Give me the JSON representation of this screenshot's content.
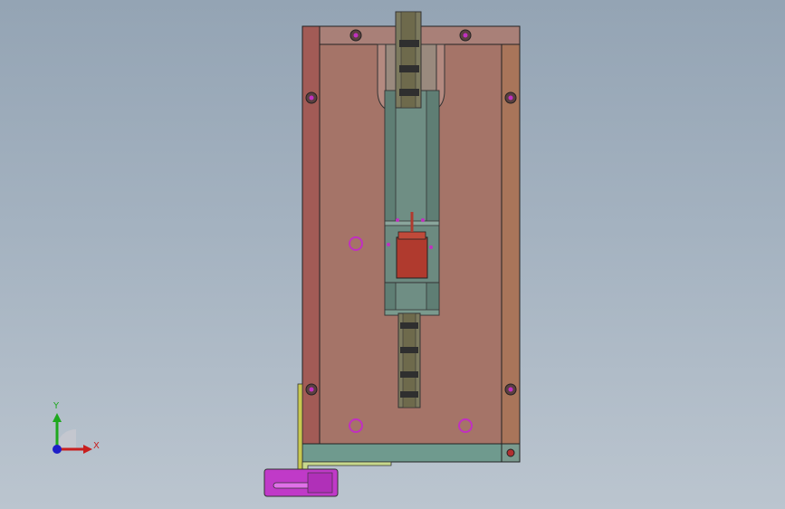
{
  "viewport": {
    "background_top": "#94a4b4",
    "background_bottom": "#bbc5cf"
  },
  "triad": {
    "y_label": "Y",
    "x_label": "X",
    "y_color": "#1ea81e",
    "x_color": "#c81e1e",
    "z_color": "#1e1ec8"
  },
  "model": {
    "base_plate_color": "#a57468",
    "left_strip_color": "#a25b56",
    "right_strip_color": "#a9755a",
    "top_strip_color": "#a98078",
    "bottom_rail_color": "#6f9a8e",
    "channel_color": "#6f8e84",
    "slider_color": "#b03a2e",
    "hole_color": "#c030c0",
    "handle_color": "#c03ac8",
    "lever_color": "#c8c850"
  }
}
